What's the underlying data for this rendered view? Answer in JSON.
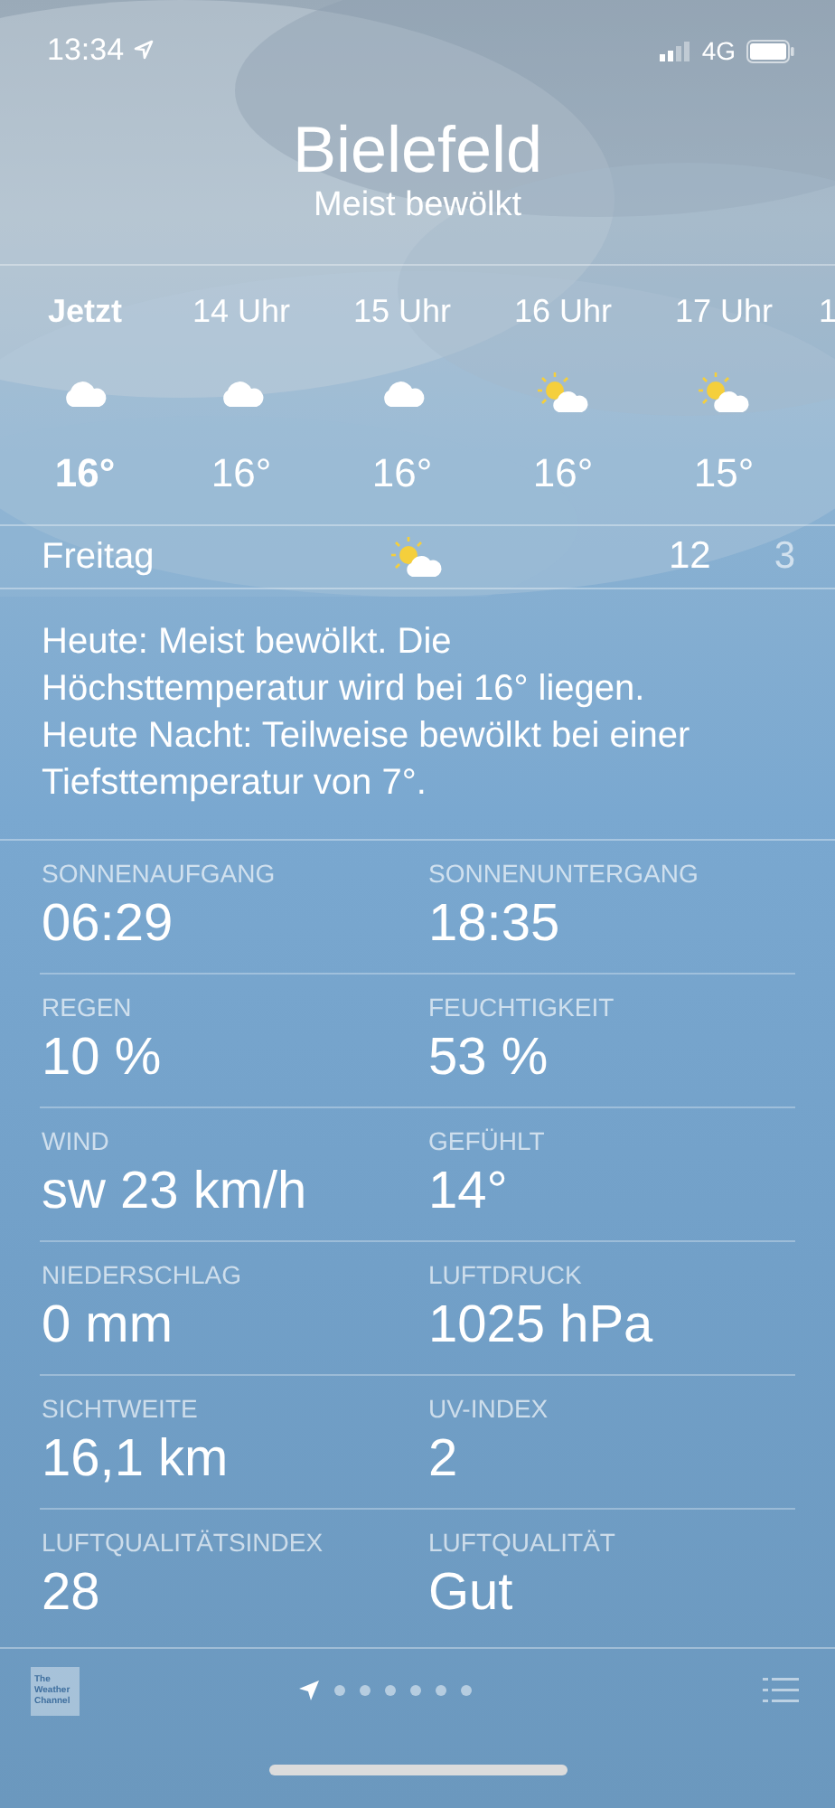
{
  "status_bar": {
    "time": "13:34",
    "network": "4G"
  },
  "header": {
    "city": "Bielefeld",
    "condition": "Meist bewölkt"
  },
  "hourly": [
    {
      "label": "Jetzt",
      "kind": "cloud",
      "temp": "16°",
      "selected": true
    },
    {
      "label": "14 Uhr",
      "kind": "cloud",
      "temp": "16°",
      "selected": false
    },
    {
      "label": "15 Uhr",
      "kind": "cloud",
      "temp": "16°",
      "selected": false
    },
    {
      "label": "16 Uhr",
      "kind": "sun-cloud",
      "temp": "16°",
      "selected": false
    },
    {
      "label": "17 Uhr",
      "kind": "sun-cloud",
      "temp": "15°",
      "selected": false
    },
    {
      "label": "1",
      "kind": "cut",
      "selected": false
    }
  ],
  "day": {
    "name": "Freitag",
    "kind": "sun-cloud",
    "high": "12",
    "low": "3"
  },
  "summary": "Heute: Meist bewölkt. Die Höchsttemperatur wird bei 16° liegen. Heute Nacht: Teilweise bewölkt bei einer Tiefsttemperatur von 7°.",
  "details": [
    {
      "label": "SONNENAUFGANG",
      "value": "06:29"
    },
    {
      "label": "SONNENUNTERGANG",
      "value": "18:35"
    },
    {
      "label": "REGEN",
      "value": "10 %"
    },
    {
      "label": "FEUCHTIGKEIT",
      "value": "53 %"
    },
    {
      "label": "WIND",
      "value": "sw 23 km/h"
    },
    {
      "label": "GEFÜHLT",
      "value": "14°"
    },
    {
      "label": "NIEDERSCHLAG",
      "value": "0 mm"
    },
    {
      "label": "LUFTDRUCK",
      "value": "1025 hPa"
    },
    {
      "label": "SICHTWEITE",
      "value": "16,1 km"
    },
    {
      "label": "UV-INDEX",
      "value": "2"
    },
    {
      "label": "LUFTQUALITÄTSINDEX",
      "value": "28"
    },
    {
      "label": "LUFTQUALITÄT",
      "value": "Gut"
    }
  ],
  "footer": {
    "logo": [
      "The",
      "Weather",
      "Channel"
    ],
    "pages": [
      {
        "kind": "location",
        "selected": true
      },
      {
        "kind": "dot",
        "selected": false
      },
      {
        "kind": "dot",
        "selected": false
      },
      {
        "kind": "dot",
        "selected": false
      },
      {
        "kind": "dot",
        "selected": false
      },
      {
        "kind": "dot",
        "selected": false
      },
      {
        "kind": "dot",
        "selected": false
      }
    ]
  }
}
